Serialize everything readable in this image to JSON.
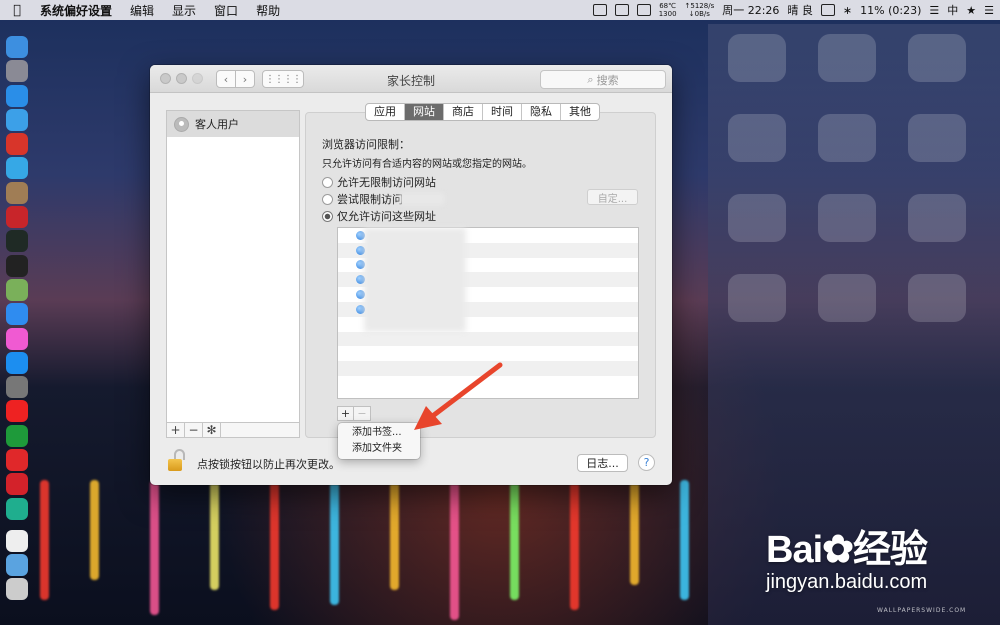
{
  "menubar": {
    "app_name": "系统偏好设置",
    "menus": [
      "编辑",
      "显示",
      "窗口",
      "帮助"
    ],
    "temp": "68℃",
    "fan": "1300",
    "net_up": "↑5128/s",
    "net_down": "↓0B/s",
    "datetime": "周一 22:26",
    "weather": "晴 良",
    "battery": "11% (0:23)",
    "input_method": "中"
  },
  "window": {
    "title": "家长控制",
    "search_placeholder": "搜索",
    "user": "客人用户",
    "tabs": [
      {
        "label": "应用",
        "active": false
      },
      {
        "label": "网站",
        "active": true
      },
      {
        "label": "商店",
        "active": false
      },
      {
        "label": "时间",
        "active": false
      },
      {
        "label": "隐私",
        "active": false
      },
      {
        "label": "其他",
        "active": false
      }
    ],
    "section_title": "浏览器访问限制：",
    "section_desc": "只允许访问有合适内容的网站或您指定的网站。",
    "options": [
      {
        "label": "允许无限制访问网站",
        "selected": false
      },
      {
        "label": "尝试限制访问",
        "selected": false
      },
      {
        "label": "仅允许访问这些网址",
        "selected": true
      }
    ],
    "customize_label": "自定...",
    "site_rows": 11,
    "add_symbol": "+",
    "remove_symbol": "−",
    "popup_items": [
      "添加书签...",
      "添加文件夹"
    ],
    "lock_text": "点按锁按钮以防止再次更改。",
    "log_label": "日志...",
    "help_label": "?"
  },
  "watermark": {
    "logo": "Bai✿经验",
    "url": "jingyan.baidu.com",
    "small": "WALLPAPERSWIDE.COM"
  },
  "colors": {
    "active_tab": "#6c6c6c",
    "arrow": "#e8452c"
  }
}
